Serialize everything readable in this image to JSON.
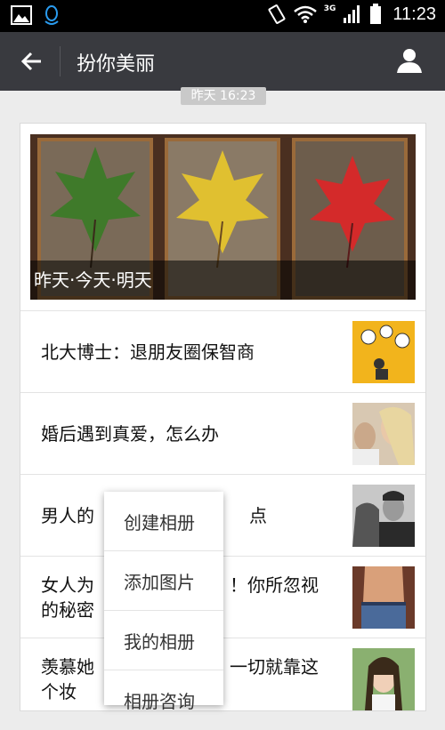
{
  "status_bar": {
    "network": "3G",
    "time": "11:23"
  },
  "title_bar": {
    "title": "扮你美丽"
  },
  "timestamp": "昨天 16:23",
  "article": {
    "hero_caption": "昨天·今天·明天",
    "items": [
      {
        "title": "北大博士：退朋友圈保智商",
        "thumb_icon": "cartoon-illustration"
      },
      {
        "title": "婚后遇到真爱，怎么办",
        "thumb_icon": "couple-photo"
      },
      {
        "title": "男人的",
        "title_tail": "点",
        "thumb_icon": "man-woman-bw-photo"
      },
      {
        "title": "女人为",
        "title_tail": "！你所忽视",
        "title_line2": "的秘密",
        "thumb_icon": "waist-jeans-photo"
      },
      {
        "title": "羡慕她",
        "title_tail": "一切就靠这",
        "title_line2": "个妆",
        "thumb_icon": "smiling-woman-photo"
      }
    ]
  },
  "popup_menu": {
    "items": [
      "创建相册",
      "添加图片",
      "我的相册",
      "相册咨询"
    ]
  }
}
